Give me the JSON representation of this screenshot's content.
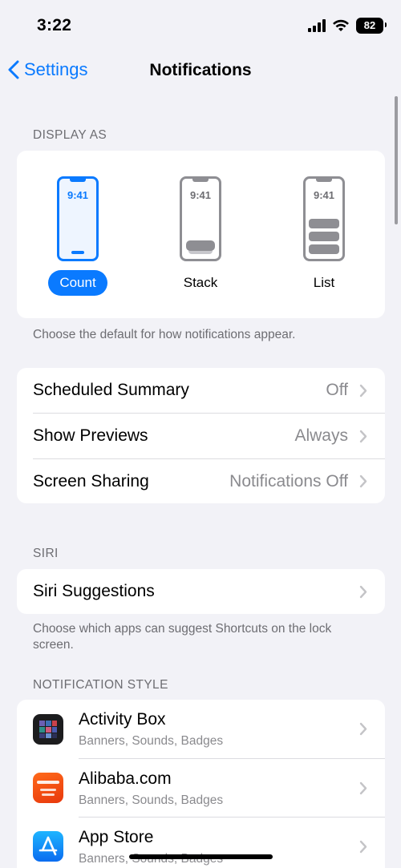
{
  "status_bar": {
    "time": "3:22",
    "battery": "82"
  },
  "nav": {
    "back_label": "Settings",
    "title": "Notifications"
  },
  "display_as": {
    "header": "DISPLAY AS",
    "options": [
      {
        "label": "Count",
        "time": "9:41",
        "selected": true
      },
      {
        "label": "Stack",
        "time": "9:41",
        "selected": false
      },
      {
        "label": "List",
        "time": "9:41",
        "selected": false
      }
    ],
    "footnote": "Choose the default for how notifications appear."
  },
  "settings_rows": [
    {
      "label": "Scheduled Summary",
      "value": "Off"
    },
    {
      "label": "Show Previews",
      "value": "Always"
    },
    {
      "label": "Screen Sharing",
      "value": "Notifications Off"
    }
  ],
  "siri": {
    "header": "SIRI",
    "row_label": "Siri Suggestions",
    "footnote": "Choose which apps can suggest Shortcuts on the lock screen."
  },
  "notification_style": {
    "header": "NOTIFICATION STYLE",
    "apps": [
      {
        "name": "Activity Box",
        "detail": "Banners, Sounds, Badges",
        "icon": "activity-box-icon"
      },
      {
        "name": "Alibaba.com",
        "detail": "Banners, Sounds, Badges",
        "icon": "alibaba-icon"
      },
      {
        "name": "App Store",
        "detail": "Banners, Sounds, Badges",
        "icon": "app-store-icon"
      }
    ]
  },
  "colors": {
    "accent": "#0a7aff",
    "background": "#f2f2f7",
    "secondary_text": "#8a8a8e"
  }
}
